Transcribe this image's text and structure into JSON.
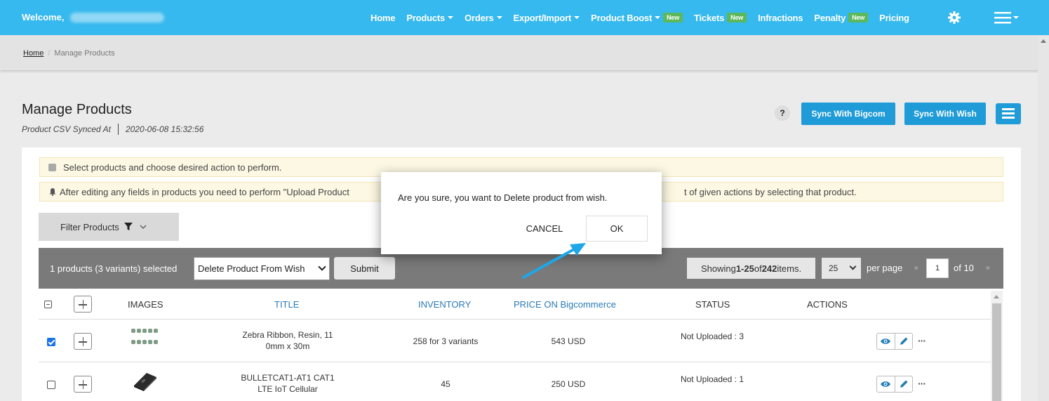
{
  "nav": {
    "welcome": "Welcome,",
    "items": [
      {
        "label": "Home",
        "caret": false,
        "badge": ""
      },
      {
        "label": "Products",
        "caret": true,
        "badge": ""
      },
      {
        "label": "Orders",
        "caret": true,
        "badge": ""
      },
      {
        "label": "Export/Import",
        "caret": true,
        "badge": ""
      },
      {
        "label": "Product Boost",
        "caret": true,
        "badge": "New"
      },
      {
        "label": "Tickets",
        "caret": false,
        "badge": "New"
      },
      {
        "label": "Infractions",
        "caret": false,
        "badge": ""
      },
      {
        "label": "Penalty",
        "caret": false,
        "badge": "New"
      },
      {
        "label": "Pricing",
        "caret": false,
        "badge": ""
      }
    ],
    "settings_icon": "gear-icon",
    "menu_icon": "hamburger-icon"
  },
  "breadcrumb": {
    "home": "Home",
    "separator": "/",
    "current": "Manage Products"
  },
  "header": {
    "title": "Manage Products",
    "sync_label": "Product CSV Synced At",
    "sync_time": "2020-06-08 15:32:56",
    "help": "?",
    "sync_bigcom": "Sync With Bigcom",
    "sync_wish": "Sync With Wish"
  },
  "alerts": {
    "select_msg": "Select products and choose desired action to perform.",
    "edit_msg": "After editing any fields in products you need to perform \"Upload Product",
    "edit_msg_tail": "t of given actions by selecting that product."
  },
  "filter": {
    "label": "Filter Products"
  },
  "toolbar": {
    "selected_text": "1 products (3 variants) selected",
    "action_value": "Delete Product From Wish",
    "submit": "Submit",
    "showing_prefix": "Showing ",
    "showing_range": "1-25",
    "showing_of": " of ",
    "showing_total": "242",
    "showing_suffix": " items.",
    "per_page_value": "25",
    "per_page_label": "per page",
    "prev": "«",
    "page_num": "1",
    "of_pages": "of 10",
    "next": "»"
  },
  "table": {
    "headers": {
      "images": "IMAGES",
      "title": "TITLE",
      "inventory": "INVENTORY",
      "price": "PRICE ON Bigcommerce",
      "status": "STATUS",
      "actions": "ACTIONS"
    },
    "rows": [
      {
        "checked": true,
        "title_line1": "Zebra Ribbon, Resin, 11",
        "title_line2": "0mm x 30m",
        "inventory": "258 for 3 variants",
        "price": "543 USD",
        "status": "Not Uploaded : 3"
      },
      {
        "checked": false,
        "title_line1": "BULLETCAT1-AT1 CAT1",
        "title_line2": "LTE IoT Cellular",
        "inventory": "45",
        "price": "250 USD",
        "status": "Not Uploaded : 1"
      }
    ]
  },
  "modal": {
    "message": "Are you sure, you want to Delete product from wish.",
    "cancel": "CANCEL",
    "ok": "OK"
  },
  "colors": {
    "nav_bg": "#36b9ee",
    "primary_button": "#1f9bd7",
    "badge_new": "#5cb85c",
    "link": "#2a7ab5",
    "alert_bg": "#fcf8e3",
    "toolbar_bg": "#7a7a7a"
  }
}
